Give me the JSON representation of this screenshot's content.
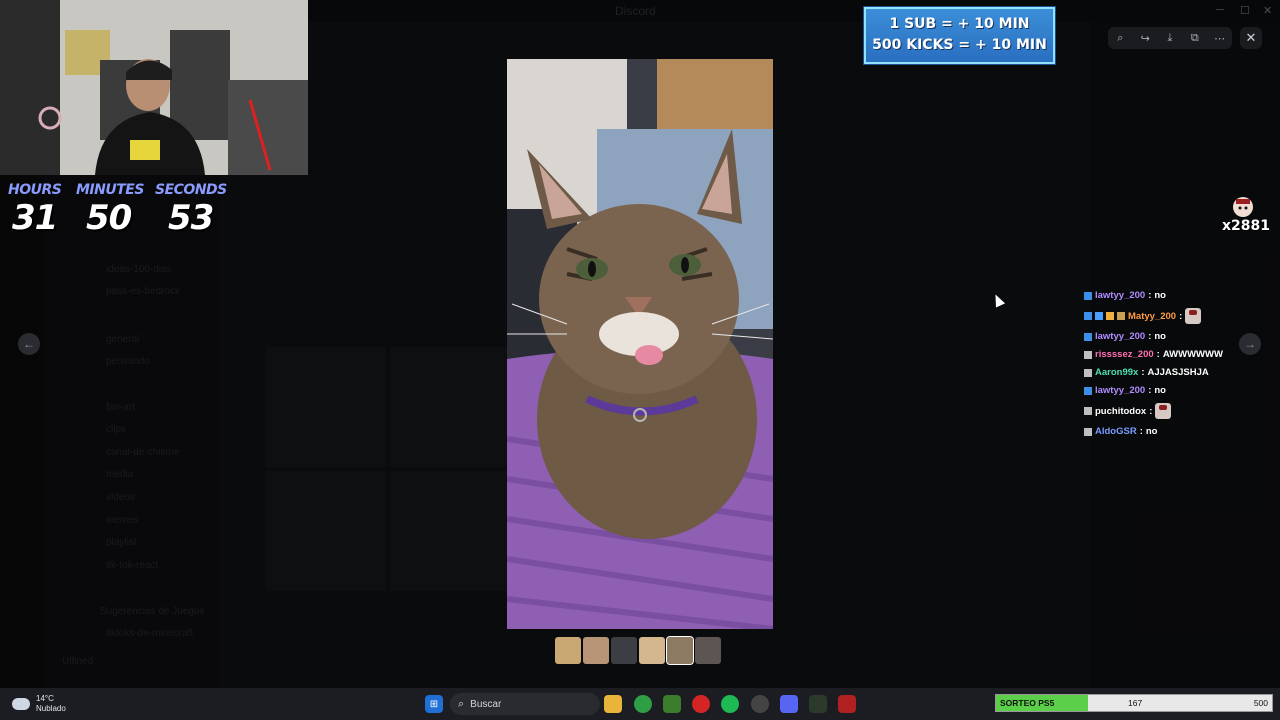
{
  "app": {
    "window_title": "Discord"
  },
  "background": {
    "channels": [
      "ideas-100-dias",
      "pass-es-bedrock",
      "general",
      "pensando",
      "fan-art",
      "clips",
      "canal-de-chisme",
      "media",
      "videos",
      "memes",
      "playlist",
      "tik-tok-react",
      "Sugerencias de Juegos",
      "tiktoks-de-minecraft"
    ],
    "user_name": "Ulfined"
  },
  "viewer": {
    "toolbar": [
      "zoom-icon",
      "share-icon",
      "download-icon",
      "open-external-icon",
      "more-icon"
    ],
    "close_label": "✕",
    "prev_label": "←",
    "next_label": "→",
    "thumbnails": 6
  },
  "timer": {
    "hours_label": "HOURS",
    "minutes_label": "MINUTES",
    "seconds_label": "SECONDS",
    "hours": "31",
    "minutes": "50",
    "seconds": "53"
  },
  "banner": {
    "line1": "1 SUB = + 10 MIN",
    "line2": "500 KICKS = + 10 MIN"
  },
  "counter": {
    "value": "x2881"
  },
  "chat": [
    {
      "user": "lawtyy_200",
      "text": "no",
      "color": "#b08cff"
    },
    {
      "user": "Matyy_200",
      "text": "",
      "color": "#ff9b45",
      "emote": true
    },
    {
      "user": "lawtyy_200",
      "text": "no",
      "color": "#b08cff"
    },
    {
      "user": "rissssez_200",
      "text": "AWWWWWW",
      "color": "#ff6fb1"
    },
    {
      "user": "Aaron99x",
      "text": "AJJASJSHJA",
      "color": "#50e0b0"
    },
    {
      "user": "lawtyy_200",
      "text": "no",
      "color": "#b08cff"
    },
    {
      "user": "puchitodox",
      "text": "",
      "color": "#ffffff",
      "emote": true
    },
    {
      "user": "AldoGSR",
      "text": "no",
      "color": "#7a9cff"
    }
  ],
  "taskbar": {
    "temp": "14°C",
    "weather": "Nublado",
    "search_placeholder": "Buscar"
  },
  "giveaway": {
    "label": "SORTEO PS5",
    "current": "167",
    "max": "500",
    "progress": 0.334
  }
}
